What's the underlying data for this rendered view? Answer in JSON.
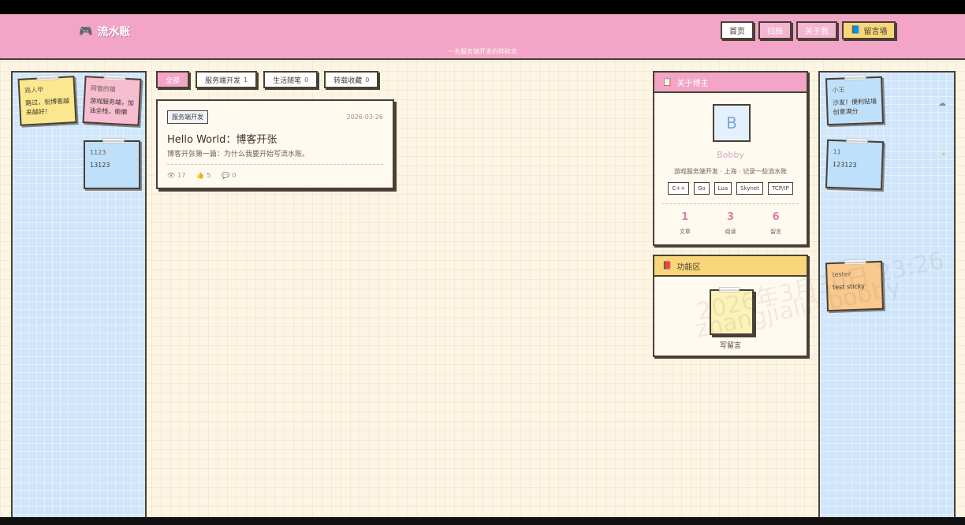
{
  "header": {
    "title": "流水账",
    "subtitle": "一名服务端开发的碎碎念",
    "nav": [
      {
        "label": "首页"
      },
      {
        "label": "归档"
      },
      {
        "label": "关于我"
      },
      {
        "label": "留言墙"
      }
    ]
  },
  "filters": [
    {
      "label": "全部",
      "count": ""
    },
    {
      "label": "服务端开发",
      "count": "1"
    },
    {
      "label": "生活随笔",
      "count": "0"
    },
    {
      "label": "转载收藏",
      "count": "0"
    }
  ],
  "post": {
    "tag": "服务端开发",
    "date": "2026-03-26",
    "title": "Hello World：博客开张",
    "excerpt": "博客开张第一篇：为什么我要开始写流水账。",
    "views": "17",
    "likes": "5",
    "comments": "0"
  },
  "left_stickies": [
    {
      "author": "路人甲",
      "text": "路过，祝博客越来越好！"
    },
    {
      "author": "网管的猫",
      "text": "游戏服务端，加油全栈，偷懒"
    },
    {
      "author": "1123",
      "text": "13123"
    }
  ],
  "right_stickies": [
    {
      "author": "小王",
      "text": "沙发！便利贴墙创意满分"
    },
    {
      "author": "11",
      "text": "123123"
    },
    {
      "author": "tester",
      "text": "test sticky"
    }
  ],
  "profile": {
    "header": "关于博主",
    "avatar_letter": "B",
    "name": "Bobby",
    "bio": "游戏服务端开发 · 上海 · 记录一些流水账",
    "skills": [
      "C++",
      "Go",
      "Lua",
      "Skynet",
      "TCP/IP"
    ],
    "stats": [
      {
        "num": "1",
        "label": "文章"
      },
      {
        "num": "3",
        "label": "阅读"
      },
      {
        "num": "6",
        "label": "留言"
      }
    ]
  },
  "func": {
    "header": "功能区",
    "note_label": "写留言"
  },
  "watermark": {
    "line1": "2026年3月30日 23:26",
    "line2": "zhangjialin.bobby"
  },
  "icons": {
    "logo": "gamepad-icon",
    "guestbook": "notebook-icon",
    "profile": "clipboard-icon",
    "func": "book-icon"
  },
  "colors": {
    "header_pink": "#f2a5c6",
    "accent_gold": "#f7d77a",
    "wall_blue": "#cfe6fb",
    "paper": "#fdf5e4",
    "ink": "#4a3f35"
  }
}
